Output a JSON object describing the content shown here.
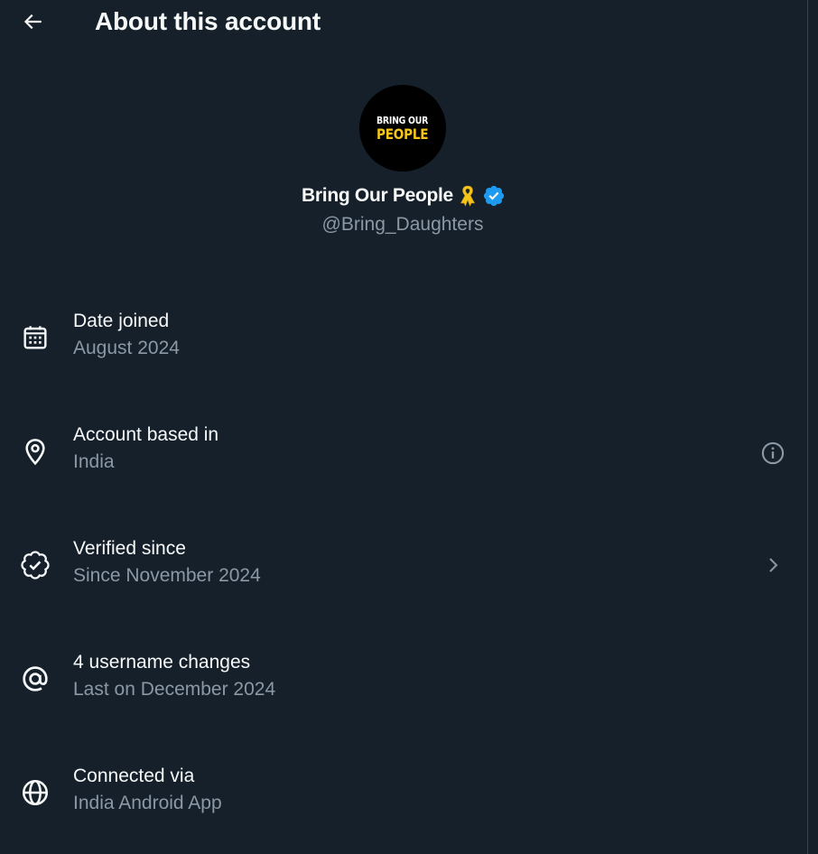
{
  "header": {
    "title": "About this account",
    "back_icon": "arrow-left-icon"
  },
  "profile": {
    "avatar_line1": "BRING OUR",
    "avatar_line2": "PEOPLE",
    "display_name": "Bring Our People",
    "name_emoji": "yellow-ribbon-icon",
    "verified_icon": "verified-badge-icon",
    "handle": "@Bring_Daughters"
  },
  "rows": [
    {
      "icon": "calendar-icon",
      "label": "Date joined",
      "value": "August 2024"
    },
    {
      "icon": "location-pin-icon",
      "label": "Account based in",
      "value": "India",
      "action_icon": "info-icon"
    },
    {
      "icon": "verified-outline-icon",
      "label": "Verified since",
      "value": "Since November 2024",
      "action_icon": "chevron-right-icon"
    },
    {
      "icon": "at-sign-icon",
      "label": "4 username changes",
      "value": "Last on December 2024"
    },
    {
      "icon": "globe-icon",
      "label": "Connected via",
      "value": "India Android App"
    }
  ],
  "colors": {
    "background": "#15202b",
    "primary_text": "#f7f9f9",
    "secondary_text": "#8b98a5",
    "verified_blue": "#1d9bf0",
    "ribbon_yellow": "#f5c518",
    "border": "#38444d"
  }
}
